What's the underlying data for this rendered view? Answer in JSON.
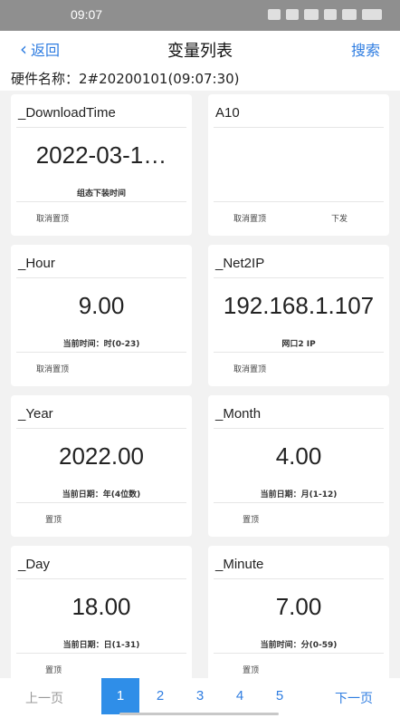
{
  "status": {
    "time": "09:07"
  },
  "nav": {
    "back_label": "返回",
    "title": "变量列表",
    "search_label": "搜索"
  },
  "hardware": {
    "label": "硬件名称：2#20200101(09:07:30)"
  },
  "cards": [
    {
      "name": "_DownloadTime",
      "value": "2022-03-1…",
      "desc": "组态下装时间",
      "actions": [
        "取消置顶",
        ""
      ]
    },
    {
      "name": "A10",
      "value": "",
      "desc": "",
      "actions": [
        "取消置顶",
        "下发"
      ]
    },
    {
      "name": "_Hour",
      "value": "9.00",
      "desc": "当前时间：时(0-23)",
      "actions": [
        "取消置顶",
        ""
      ]
    },
    {
      "name": "_Net2IP",
      "value": "192.168.1.107",
      "desc": "网口2 IP",
      "actions": [
        "取消置顶",
        ""
      ]
    },
    {
      "name": "_Year",
      "value": "2022.00",
      "desc": "当前日期：年(4位数)",
      "actions": [
        "置顶",
        ""
      ]
    },
    {
      "name": "_Month",
      "value": "4.00",
      "desc": "当前日期：月(1-12)",
      "actions": [
        "置顶",
        ""
      ]
    },
    {
      "name": "_Day",
      "value": "18.00",
      "desc": "当前日期：日(1-31)",
      "actions": [
        "置顶",
        ""
      ]
    },
    {
      "name": "_Minute",
      "value": "7.00",
      "desc": "当前时间：分(0-59)",
      "actions": [
        "置顶",
        ""
      ]
    }
  ],
  "pager": {
    "prev_label": "上一页",
    "pages": [
      "1",
      "2",
      "3",
      "4",
      "5"
    ],
    "current": "1",
    "next_label": "下一页"
  },
  "colors": {
    "accent": "#2f7de1",
    "active_page": "#2f8ee8",
    "statusbar": "#8f8f8f"
  }
}
